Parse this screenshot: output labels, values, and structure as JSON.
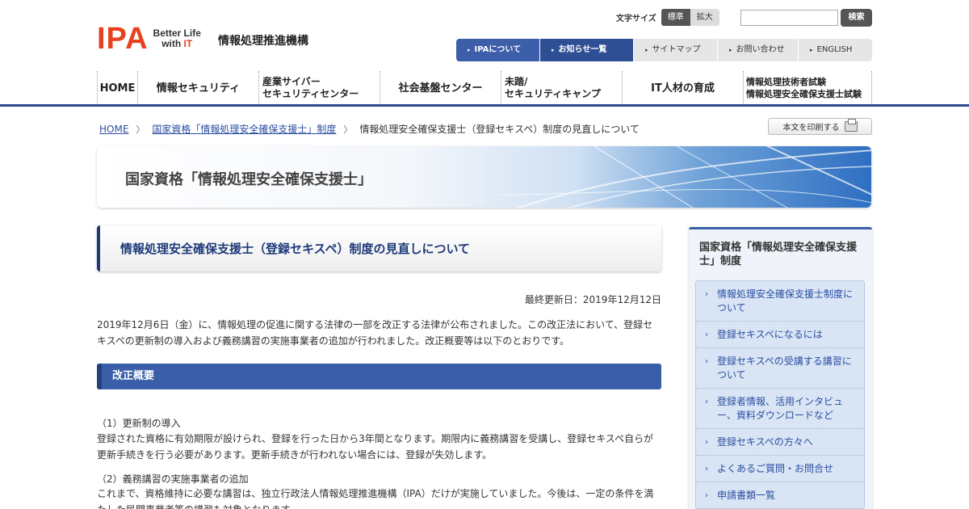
{
  "header": {
    "logo_text": "IPA",
    "logo_tagline_1": "Better Life",
    "logo_tagline_2": "with",
    "logo_tagline_it": "IT",
    "org_name": "情報処理推進機構",
    "font_size_label": "文字サイズ",
    "font_size_standard": "標準",
    "font_size_large": "拡大",
    "search_placeholder": "",
    "search_button": "検索"
  },
  "util_nav": [
    {
      "label": "IPAについて"
    },
    {
      "label": "お知らせ一覧"
    },
    {
      "label": "サイトマップ"
    },
    {
      "label": "お問い合わせ"
    },
    {
      "label": "ENGLISH"
    }
  ],
  "global_nav": [
    {
      "label": "HOME"
    },
    {
      "label": "情報セキュリティ"
    },
    {
      "label_1": "産業サイバー",
      "label_2": "セキュリティセンター"
    },
    {
      "label": "社会基盤センター"
    },
    {
      "label_1": "未踏/",
      "label_2": "セキュリティキャンプ"
    },
    {
      "label": "IT人材の育成"
    },
    {
      "label_1": "情報処理技術者試験",
      "label_2": "情報処理安全確保支援士試験"
    }
  ],
  "breadcrumb": {
    "home": "HOME",
    "parent": "国家資格「情報処理安全確保支援士」制度",
    "current": "情報処理安全確保支援士（登録セキスペ）制度の見直しについて",
    "sep": "〉"
  },
  "print_button": "本文を印刷する",
  "banner_title": "国家資格「情報処理安全確保支援士」",
  "main": {
    "title": "情報処理安全確保支援士（登録セキスペ）制度の見直しについて",
    "updated": "最終更新日：2019年12月12日",
    "intro": "2019年12月6日（金）に、情報処理の促進に関する法律の一部を改正する法律が公布されました。この改正法において、登録セキスペの更新制の導入および義務講習の実施事業者の追加が行われました。改正概要等は以下のとおりです。",
    "section_heading": "改正概要",
    "item1_title": "（1）更新制の導入",
    "item1_body": "登録された資格に有効期限が設けられ、登録を行った日から3年間となります。期限内に義務講習を受講し、登録セキスペ自らが更新手続きを行う必要があります。更新手続きが行われない場合には、登録が失効します。",
    "item2_title": "（2）義務講習の実施事業者の追加",
    "item2_body": "これまで、資格維持に必要な講習は、独立行政法人情報処理推進機構（IPA）だけが実施していました。今後は、一定の条件を満たした民間事業者等の講習も対象となります。"
  },
  "sidebar": {
    "title": "国家資格「情報処理安全確保支援士」制度",
    "chevron": "›",
    "items": [
      {
        "label": "情報処理安全確保支援士制度について"
      },
      {
        "label": "登録セキスペになるには"
      },
      {
        "label": "登録セキスペの受講する講習について"
      },
      {
        "label": "登録者情報、活用インタビュー、資料ダウンロードなど"
      },
      {
        "label": "登録セキスペの方々へ"
      },
      {
        "label": "よくあるご質問・お問合せ"
      },
      {
        "label": "申請書類一覧"
      }
    ]
  },
  "colors": {
    "brand_red": "#e8411f",
    "nav_blue": "#3d5ea8",
    "title_navy": "#1d3a7a",
    "link_blue": "#2b4ea2"
  }
}
